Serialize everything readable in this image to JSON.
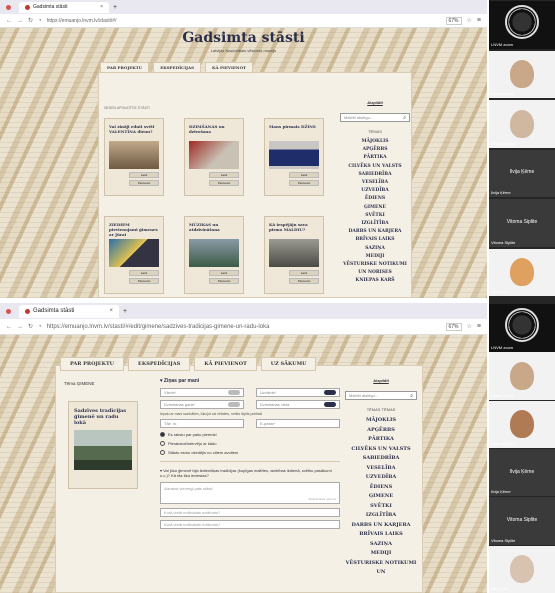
{
  "screen1": {
    "tab_title": "Gadsimta stāsti",
    "url": "https://emuanjo.lnvm.lv/stasti/#/",
    "zoom": "67%",
    "site_title": "Gadsimta stāsti",
    "site_subtitle": "Latvijas Nacionālais vēstures muzejs",
    "nav": [
      "PAR PROJEKTU",
      "EKSPEDĪCIJAS",
      "KĀ PIEVIENOT"
    ],
    "cards_label": "NESEN APSKATĪTIE STĀSTI",
    "cards": [
      {
        "caption": "Vai zināji ednit svētī VALENTĪNA dienu?",
        "img": "sepia"
      },
      {
        "caption": "DZIMŠANAS un dzīvošana",
        "img": "red"
      },
      {
        "caption": "Mans pirmais DŽINS",
        "img": "blue"
      },
      {
        "caption": "ZIEDIEM pievienojami ģimenes ar Jūrai",
        "img": "teal"
      },
      {
        "caption": "MŪZIKAS un atdzīvināšana",
        "img": "forest"
      },
      {
        "caption": "Kā iespējāju sava pirmo MALDIU?",
        "img": "photo"
      }
    ],
    "card_buttons": [
      "Lasīt",
      "Pievienot"
    ],
    "sidebar": {
      "aizpildit": "Aizpildīt",
      "search_placeholder": "Meklēt atslēgu...",
      "topics_title": "TĒMAS",
      "topics": [
        "MĀJOKLIS",
        "APĢĒRBS",
        "PĀRTIKA",
        "CILVĒKS UN VALSTS",
        "SABIEDRĪBA",
        "VESELĪBA",
        "UZVEDĪBA",
        "ĒDIENS",
        "ĢIMENE",
        "SVĒTKI",
        "IZGLĪTĪBA",
        "DARBS UN KARJERA",
        "BRĪVAIS LAIKS",
        "SAZIŅA",
        "MEDIJI",
        "VĒSTURISKE NOTIKUMI UN NORISES",
        "KNIEPAS KARŠ"
      ]
    }
  },
  "screen2": {
    "tab_title": "Gadsimta stāsti",
    "url": "https://emuanjo.lnvm.lv/stasti/#/edit/gimene/sadzives-tradicijas-gimene-un-radu-loka",
    "zoom": "67%",
    "nav": [
      "PAR PROJEKTU",
      "EKSPEDĪCIJAS",
      "KĀ PIEVIENOT",
      "UZ SĀKUMU"
    ],
    "crumb": "Tēma ĢIMENE",
    "story_caption": "Sadzīves tradīcijas ģimenē un radu lokā",
    "form": {
      "section1": "Ziņas par mani",
      "fields": [
        "Vārds*",
        "Uzvārds*",
        "Dzimšanas gads*",
        "Dzimšanas vieta"
      ],
      "note": "Iepaļu ar mani sazināties, lūkojot vai vēlaties, netiks lāpīts publiski",
      "contact": [
        "Tālr. nr.",
        "E-pasts*"
      ],
      "radios": [
        "Es rakstu par pašu pieredzi",
        "Pierakstot/intervēju ar kādu",
        "Stāstu esmu dzirdējis no citiem avotiem"
      ],
      "question": "Vai jūsu ģimenē bija ikdienišķas tradīcijas (kopīgas maltītes, darbības ikdienā, svētku pasākumi u.c.)? Kā tās tika ieviestas?",
      "textarea_placeholder": "Aizrakst vienregl pats stāsti",
      "counter": "Maksimālais garums",
      "input1": "Kurā vietā notikušais notikums?",
      "input2": "Kurā vietā notikušais notikums?"
    },
    "sidebar": {
      "aizpildit": "Aizpildīt",
      "search_placeholder": "Meklēt atslēgu...",
      "topics_title": "TĒMAS TĒMAS",
      "topics": [
        "MĀJOKLIS",
        "APĢĒRBS",
        "PĀRTIKA",
        "CILVĒKS UN VALSTS",
        "SABIEDRĪBA",
        "VESELĪBA",
        "UZVEDĪBA",
        "ĒDIENS",
        "ĢIMENE",
        "SVĒTKI",
        "IZGLĪTĪBA",
        "DARBS UN KARJERA",
        "BRĪVAIS LAIKS",
        "SAZIŅA",
        "MEDIJI",
        "VĒSTURISKE NOTIKUMI UN"
      ]
    }
  },
  "participants": [
    {
      "name": "LNVM zoom",
      "type": "logo"
    },
    {
      "name": "Sanita Kalna",
      "type": "face",
      "color": "#c9a88a"
    },
    {
      "name": "Astra Spaliņa",
      "type": "face",
      "color": "#d0b7a0"
    },
    {
      "name": "Ilvija Ķēme",
      "type": "name",
      "center": "Ilvija Ķēme"
    },
    {
      "name": "Vitoma Siplite",
      "type": "name",
      "center": "Vitoma Siplite"
    },
    {
      "name": "Hiko Ķēm",
      "type": "face",
      "color": "#e0a060"
    },
    {
      "name": "LNVM zoom",
      "type": "logo"
    },
    {
      "name": "Sanita Kalna",
      "type": "face",
      "color": "#c9a88a"
    },
    {
      "name": "Astra Spaliņa",
      "type": "face",
      "color": "#b07a55"
    },
    {
      "name": "Ilvija Ķēme",
      "type": "name",
      "center": "Ilvija Ķēme"
    },
    {
      "name": "Vitoma Siplite",
      "type": "name",
      "center": "Vitoma Siplite"
    },
    {
      "name": "Inta Ķēm",
      "type": "face",
      "color": "#d8c2b0"
    }
  ]
}
